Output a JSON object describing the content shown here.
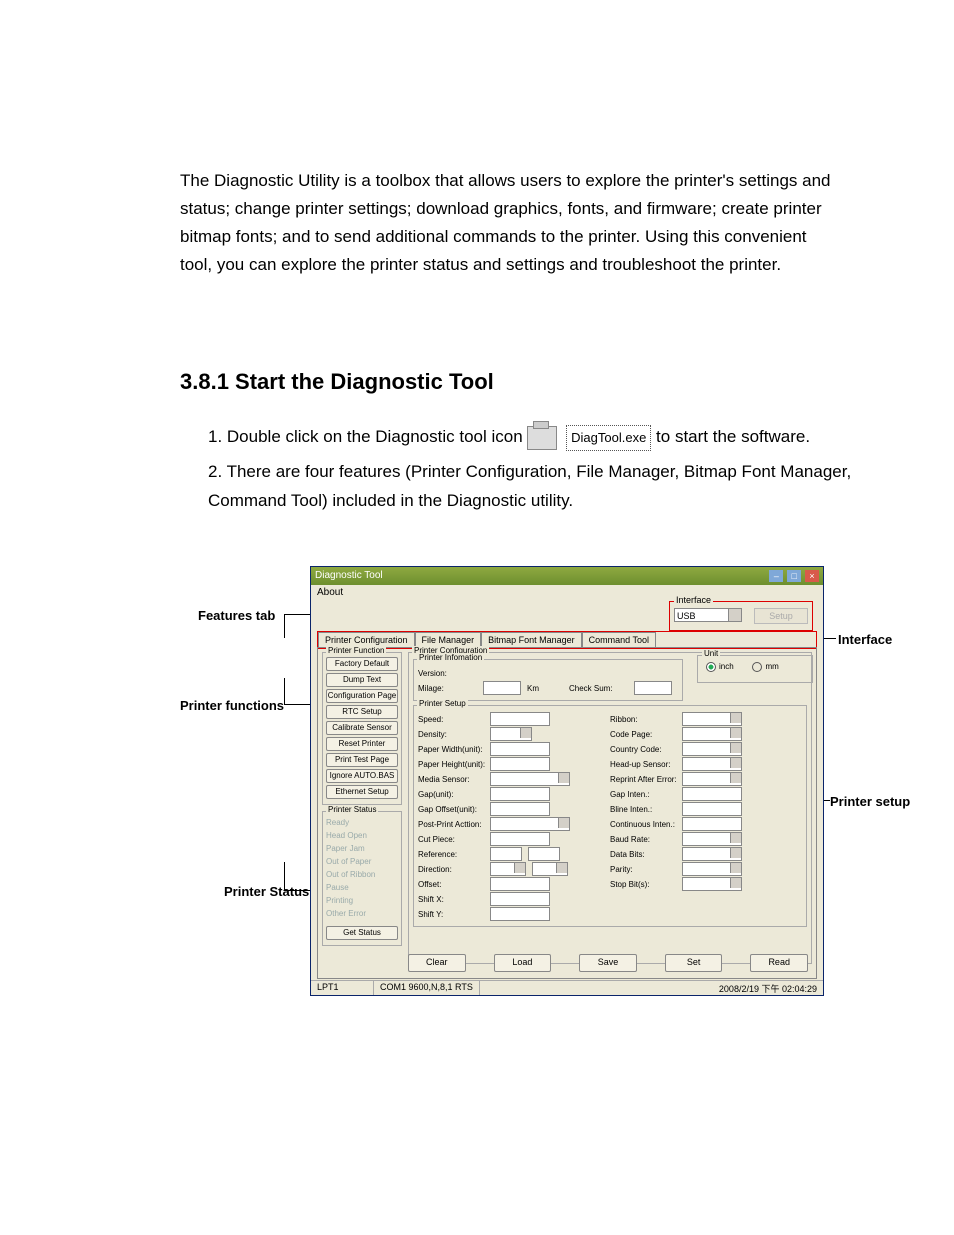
{
  "intro": "The Diagnostic Utility is a toolbox that allows users to explore the printer's settings and status; change printer settings; download graphics, fonts, and firmware; create printer bitmap fonts; and to send additional commands to the printer. Using this convenient tool, you can explore the printer status and settings and troubleshoot the printer.",
  "section_heading": "3.8.1 Start the Diagnostic Tool",
  "steps": {
    "s1a": "1. Double click on the Diagnostic tool icon",
    "s1_exe": "DiagTool.exe",
    "s1b": "to start the software.",
    "s2": "2. There are four features (Printer Configuration, File Manager, Bitmap Font Manager, Command Tool) included in the Diagnostic utility."
  },
  "callouts": {
    "features": "Features tab",
    "functions": "Printer functions",
    "status": "Printer Status",
    "interface": "Interface",
    "setup": "Printer setup"
  },
  "app": {
    "title": "Diagnostic Tool",
    "menu_about": "About",
    "interface": {
      "legend": "Interface",
      "value": "USB",
      "setup_btn": "Setup"
    },
    "tabs": [
      "Printer Configuration",
      "File Manager",
      "Bitmap Font Manager",
      "Command Tool"
    ],
    "printer_function": {
      "legend": "Printer Function",
      "buttons": [
        "Factory Default",
        "Dump Text",
        "Configuration Page",
        "RTC Setup",
        "Calibrate Sensor",
        "Reset Printer",
        "Print Test Page",
        "Ignore AUTO.BAS",
        "Ethernet Setup"
      ]
    },
    "printer_status": {
      "legend": "Printer Status",
      "items": [
        "Ready",
        "Head Open",
        "Paper Jam",
        "Out of Paper",
        "Out of Ribbon",
        "Pause",
        "Printing",
        "Other Error"
      ],
      "get_status": "Get Status"
    },
    "printer_config": {
      "legend": "Printer Configuration",
      "info_legend": "Printer Infomation",
      "info": {
        "version": "Version:",
        "milage": "Milage:",
        "milage_unit": "Km",
        "checksum": "Check Sum:"
      },
      "unit": {
        "legend": "Unit",
        "inch": "inch",
        "mm": "mm"
      },
      "setup_legend": "Printer Setup",
      "left_labels": [
        "Speed:",
        "Density:",
        "Paper Width(unit):",
        "Paper Height(unit):",
        "Media Sensor:",
        "Gap(unit):",
        "Gap Offset(unit):",
        "Post-Print Acttion:",
        "Cut Piece:",
        "Reference:",
        "Direction:",
        "Offset:",
        "Shift X:",
        "Shift Y:"
      ],
      "right_labels": [
        "Ribbon:",
        "Code Page:",
        "Country Code:",
        "Head-up Sensor:",
        "Reprint After Error:",
        "Gap Inten.:",
        "Bline Inten.:",
        "Continuous Inten.:",
        "Baud Rate:",
        "Data Bits:",
        "Parity:",
        "Stop Bit(s):"
      ]
    },
    "bottom_buttons": [
      "Clear",
      "Load",
      "Save",
      "Set",
      "Read"
    ],
    "statusbar": {
      "port": "LPT1",
      "com": "COM1 9600,N,8,1 RTS",
      "time": "2008/2/19 下午 02:04:29"
    }
  }
}
